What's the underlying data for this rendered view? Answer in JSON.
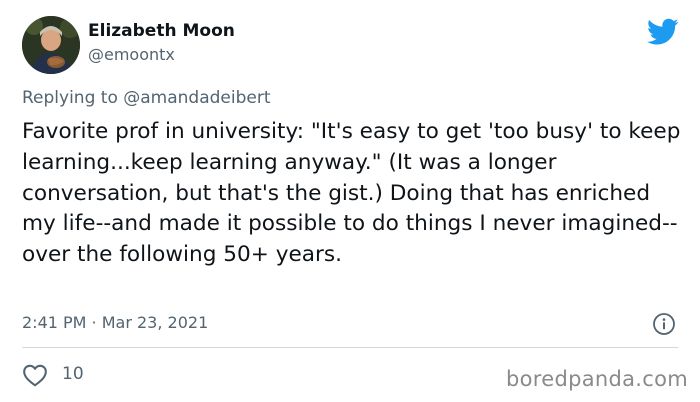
{
  "author": {
    "display_name": "Elizabeth Moon",
    "handle": "@emoontx"
  },
  "reply": {
    "prefix": "Replying to",
    "mention": "@amandadeibert"
  },
  "tweet": {
    "text": "Favorite prof in university:  \"It's easy to get 'too busy' to keep learning...keep learning anyway.\" (It was a longer conversation, but that's the gist.)  Doing that has enriched my life--and made it possible to do things I never imagined--over the following 50+ years.",
    "timestamp": "2:41 PM · Mar 23, 2021"
  },
  "actions": {
    "like_count": "10"
  },
  "watermark": "boredpanda.com",
  "colors": {
    "twitter_blue": "#1d9bf0",
    "secondary_text": "#536471",
    "divider": "#cfd9de"
  },
  "icons": {
    "brand": "twitter-bird-icon",
    "info": "info-icon",
    "like": "heart-icon"
  }
}
